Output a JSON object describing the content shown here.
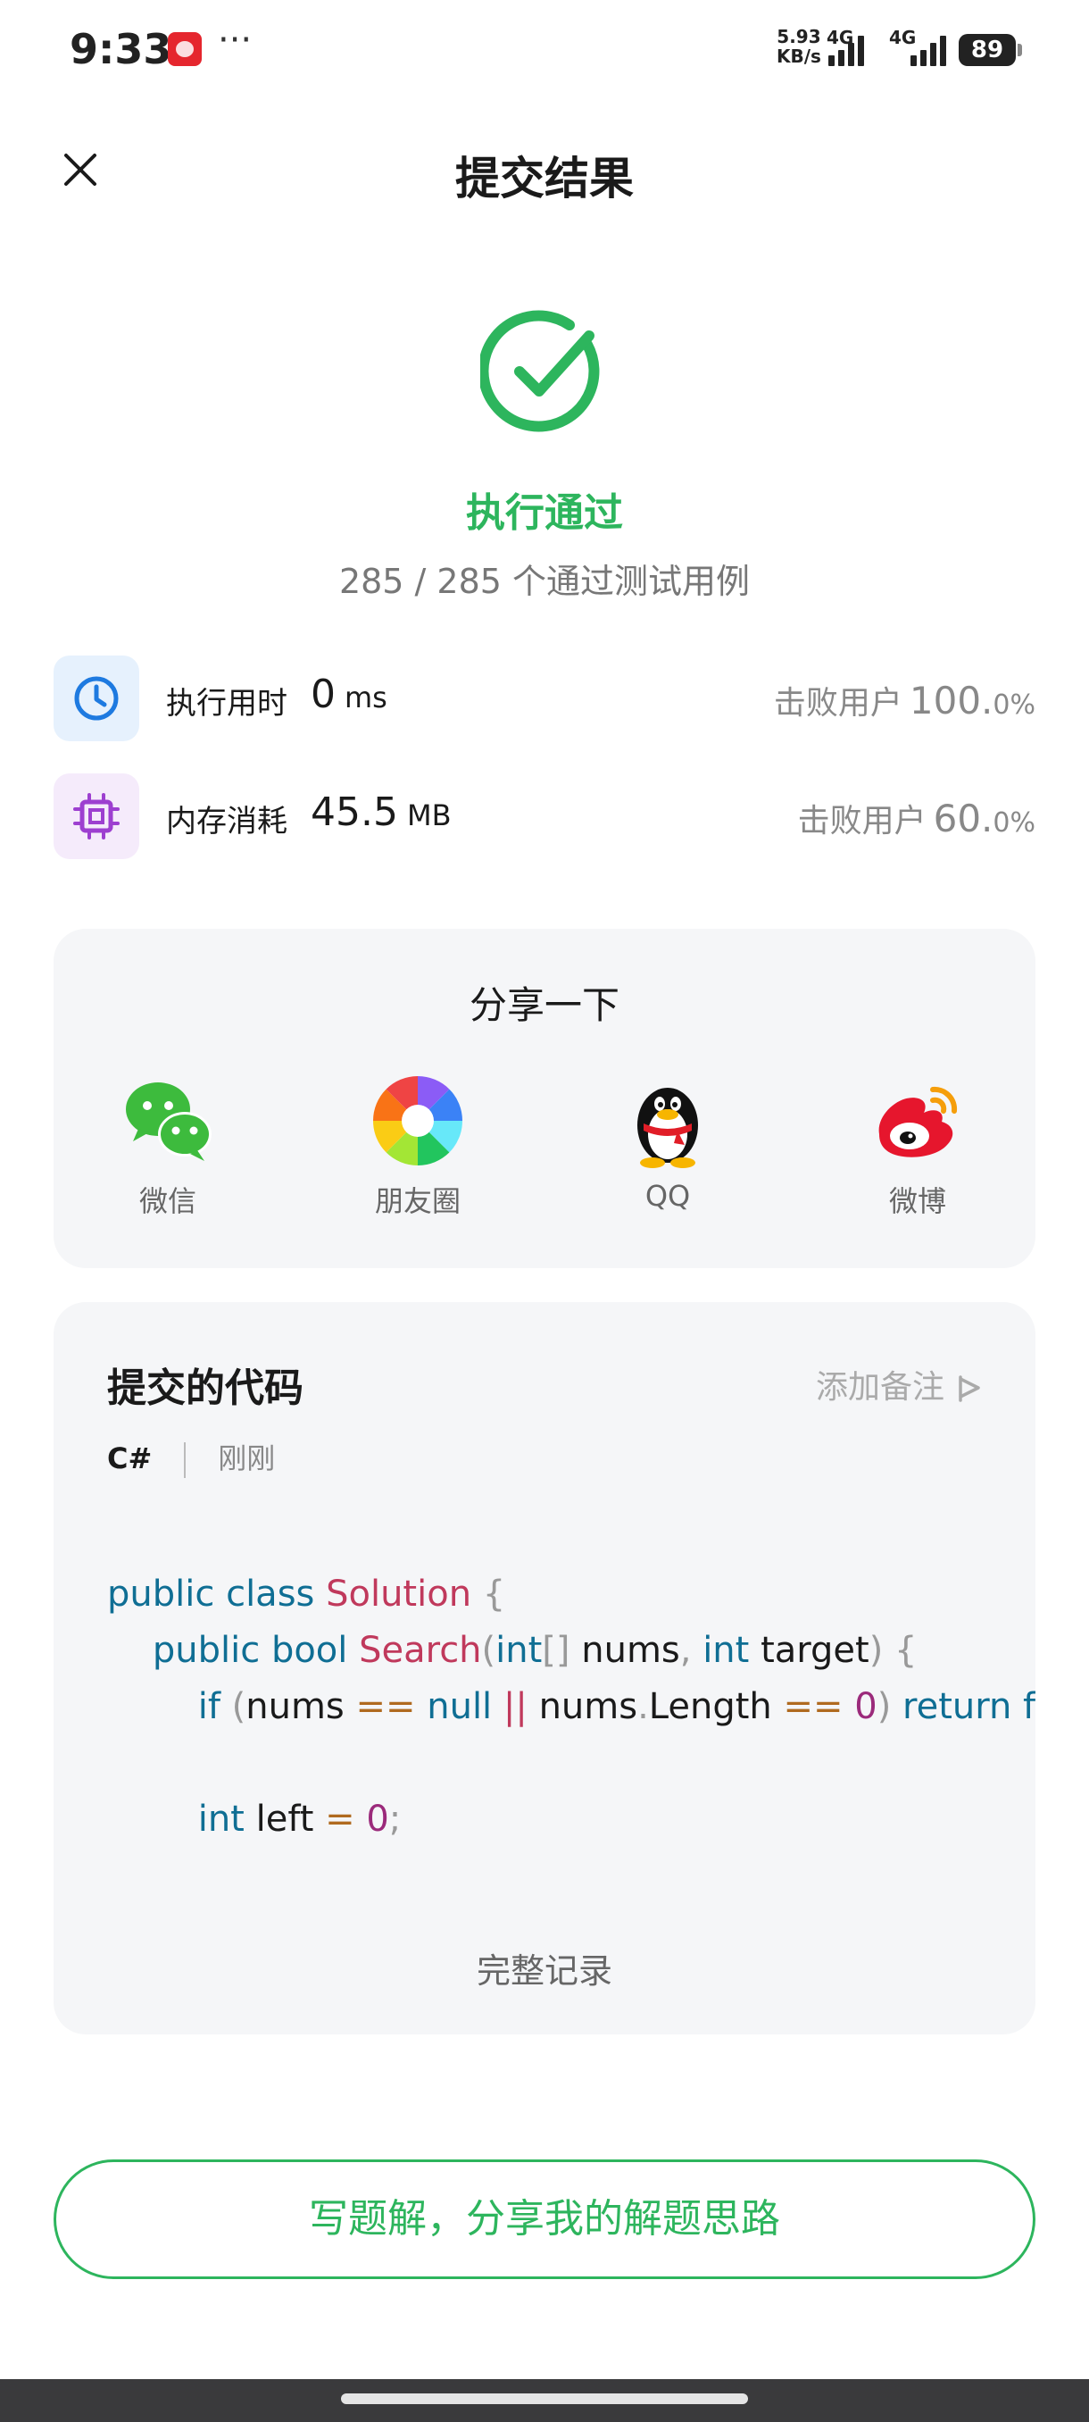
{
  "status_bar": {
    "time": "9:33",
    "dots": "···",
    "net_speed_value": "5.93",
    "net_speed_unit": "KB/s",
    "sim1": "4G",
    "sim2": "4G",
    "battery": "89"
  },
  "header": {
    "title": "提交结果"
  },
  "result": {
    "status": "执行通过",
    "testcases": "285 / 285 个通过测试用例"
  },
  "stats": [
    {
      "label": "执行用时",
      "value": "0",
      "unit": "ms",
      "beat_label": "击败用户",
      "beat_pct": "100.",
      "beat_dec": "0%"
    },
    {
      "label": "内存消耗",
      "value": "45.5",
      "unit": "MB",
      "beat_label": "击败用户",
      "beat_pct": "60.",
      "beat_dec": "0%"
    }
  ],
  "share": {
    "title": "分享一下",
    "items": [
      {
        "label": "微信"
      },
      {
        "label": "朋友圈"
      },
      {
        "label": "QQ"
      },
      {
        "label": "微博"
      }
    ]
  },
  "code_card": {
    "title": "提交的代码",
    "add_note": "添加备注",
    "language": "C#",
    "time": "刚刚",
    "full_record": "完整记录",
    "tokens": {
      "public": "public",
      "class": "class",
      "solution": "Solution",
      "lbrace": "{",
      "bool": "bool",
      "search": "Search",
      "lparen": "(",
      "int": "int",
      "brackets": "[]",
      "nums": "nums",
      "comma": ",",
      "target": "target",
      "rparen": ")",
      "if": "if",
      "eq": "==",
      "null": "null",
      "or": "||",
      "dot": ".",
      "length": "Length",
      "zero": "0",
      "return_fals": "return fals",
      "left": "left",
      "assign": "=",
      "semicolon": ";"
    }
  },
  "bottom_button": {
    "label": "写题解，分享我的解题思路"
  },
  "colors": {
    "accent_green": "#2db55d",
    "keyword_blue": "#0f6e94",
    "class_red": "#c0395c",
    "number_purple": "#9b2a7b",
    "operator_orange": "#b06a1f",
    "card_bg": "#f5f6f8"
  },
  "icons": {
    "close": "close-icon",
    "check": "check-circle-icon",
    "clock": "clock-icon",
    "memory": "chip-icon",
    "wechat": "wechat-icon",
    "moments": "moments-icon",
    "qq": "qq-penguin-icon",
    "weibo": "weibo-icon",
    "note": "flag-icon"
  }
}
